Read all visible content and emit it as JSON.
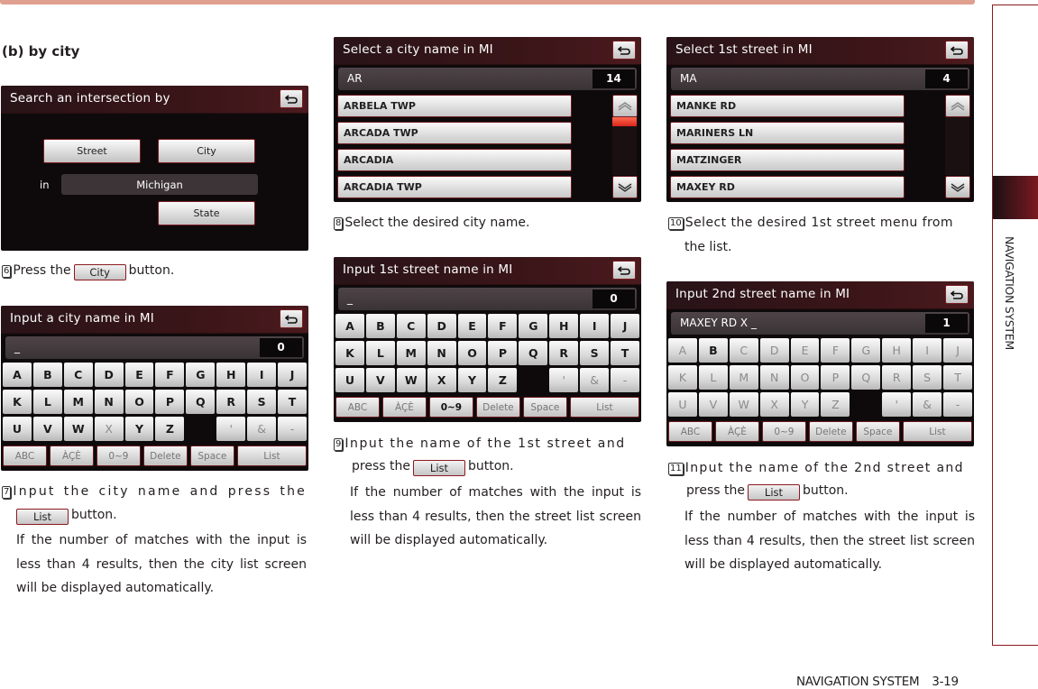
{
  "section_title": "(b) by city",
  "side_label": "NAVIGATION SYSTEM",
  "footer": {
    "section": "NAVIGATION SYSTEM",
    "page": "3-19"
  },
  "colors": {
    "accent": "#8b1a1f",
    "top_bar": "#e0a090",
    "screen_bg": "#0e0a0b",
    "scroll_thumb": "#e8402c"
  },
  "screens": {
    "search_by": {
      "title": "Search an intersection by",
      "street_label": "Street",
      "city_label": "City",
      "in_label": "in",
      "state_value": "Michigan",
      "state_label": "State"
    },
    "input_city": {
      "title": "Input a city name in MI",
      "input_value": "_",
      "count": "0",
      "rows": [
        [
          "A",
          "B",
          "C",
          "D",
          "E",
          "F",
          "G",
          "H",
          "I",
          "J"
        ],
        [
          "K",
          "L",
          "M",
          "N",
          "O",
          "P",
          "Q",
          "R",
          "S",
          "T"
        ],
        [
          "U",
          "V",
          "W",
          "X",
          "Y",
          "Z",
          "",
          "'",
          "&",
          "-"
        ]
      ],
      "enabled": "ABCDEFGHIJKLMNOPQRSTUVWYZ",
      "fn": [
        "ABC",
        "ÀÇÈ",
        "0~9",
        "Delete",
        "Space",
        "List"
      ]
    },
    "select_city": {
      "title": "Select a city name in MI",
      "input_value": "AR",
      "count": "14",
      "items": [
        "ARBELA TWP",
        "ARCADA TWP",
        "ARCADIA",
        "ARCADIA TWP"
      ],
      "scroll_position": 0
    },
    "input_street1": {
      "title": "Input 1st street name in MI",
      "input_value": "_",
      "count": "0",
      "rows": [
        [
          "A",
          "B",
          "C",
          "D",
          "E",
          "F",
          "G",
          "H",
          "I",
          "J"
        ],
        [
          "K",
          "L",
          "M",
          "N",
          "O",
          "P",
          "Q",
          "R",
          "S",
          "T"
        ],
        [
          "U",
          "V",
          "W",
          "X",
          "Y",
          "Z",
          "",
          "'",
          "&",
          "-"
        ]
      ],
      "enabled": "ABCDEFGHIJKLMNOPQRSTUVWXYZ",
      "fn": [
        "ABC",
        "ÀÇÈ",
        "0~9",
        "Delete",
        "Space",
        "List"
      ]
    },
    "select_street1": {
      "title": "Select 1st street in MI",
      "input_value": "MA",
      "count": "4",
      "items": [
        "MANKE RD",
        "MARINERS LN",
        "MATZINGER",
        "MAXEY RD"
      ]
    },
    "input_street2": {
      "title": "Input 2nd street name in MI",
      "input_value": "MAXEY RD X _",
      "count": "1",
      "rows": [
        [
          "A",
          "B",
          "C",
          "D",
          "E",
          "F",
          "G",
          "H",
          "I",
          "J"
        ],
        [
          "K",
          "L",
          "M",
          "N",
          "O",
          "P",
          "Q",
          "R",
          "S",
          "T"
        ],
        [
          "U",
          "V",
          "W",
          "X",
          "Y",
          "Z",
          "",
          "'",
          "&",
          "-"
        ]
      ],
      "enabled": "B",
      "fn": [
        "ABC",
        "ÀÇÈ",
        "0~9",
        "Delete",
        "Space",
        "List"
      ]
    }
  },
  "steps": {
    "s6": {
      "num": "6",
      "pre": "Press the",
      "btn": "City",
      "post": "button."
    },
    "s7": {
      "num": "7",
      "line1": "Input the city name and press the",
      "btn": "List",
      "post": "button.",
      "body": "If the number of matches with the input is less than 4 results, then the city list screen will be displayed automatically."
    },
    "s8": {
      "num": "8",
      "text": "Select the desired city name."
    },
    "s9": {
      "num": "9",
      "line1": "Input the name of the 1st street and",
      "pre": "press the",
      "btn": "List",
      "post": "button.",
      "body": "If the number of matches with the input is less than 4 results, then the street list screen will be displayed automatically."
    },
    "s10": {
      "num": "10",
      "line1": "Select the desired 1st street menu from",
      "line2": "the list."
    },
    "s11": {
      "num": "11",
      "line1": "Input the name of the 2nd street and",
      "pre": "press the",
      "btn": "List",
      "post": "button.",
      "body": "If the number of matches with the input is less than 4 results, then the street list screen will be displayed automatically."
    }
  }
}
